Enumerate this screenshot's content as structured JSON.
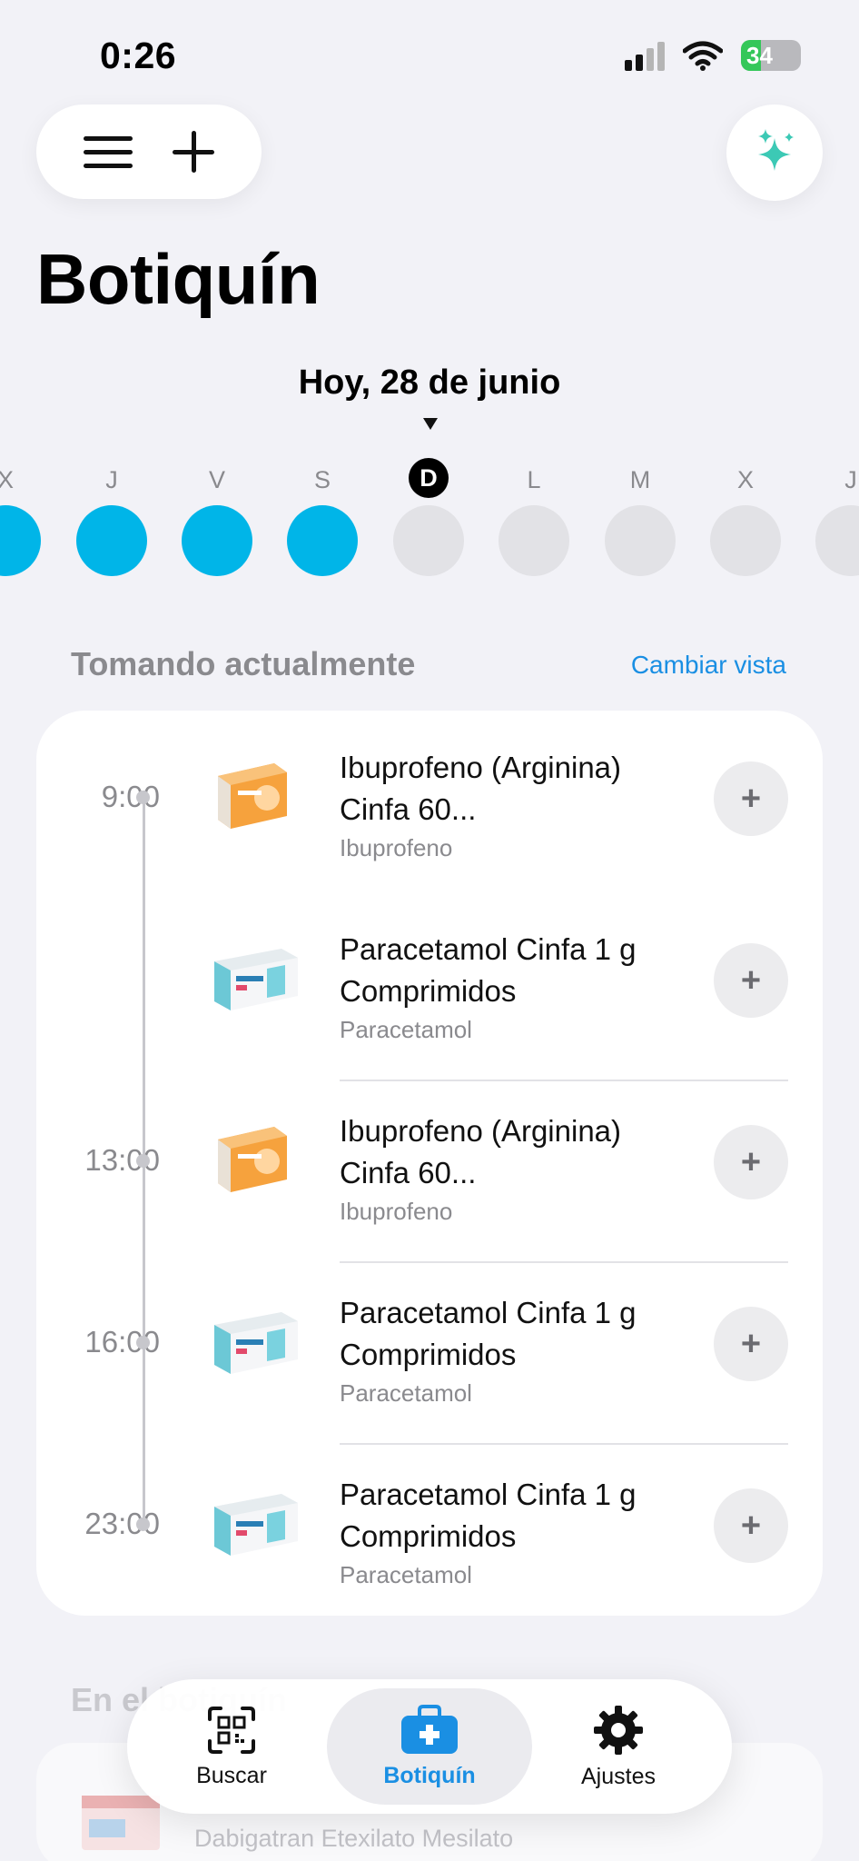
{
  "status_bar": {
    "time": "0:26",
    "battery": "34"
  },
  "header": {
    "title": "Botiquín"
  },
  "date_strip": {
    "label": "Hoy, 28 de junio",
    "days": [
      {
        "letter": "X",
        "taken": true,
        "today": false
      },
      {
        "letter": "J",
        "taken": true,
        "today": false
      },
      {
        "letter": "V",
        "taken": true,
        "today": false
      },
      {
        "letter": "S",
        "taken": true,
        "today": false
      },
      {
        "letter": "D",
        "taken": false,
        "today": true
      },
      {
        "letter": "L",
        "taken": false,
        "today": false
      },
      {
        "letter": "M",
        "taken": false,
        "today": false
      },
      {
        "letter": "X",
        "taken": false,
        "today": false
      },
      {
        "letter": "J",
        "taken": false,
        "today": false
      }
    ]
  },
  "current_section": {
    "title": "Tomando actualmente",
    "action": "Cambiar vista",
    "items": [
      {
        "time": "9:00",
        "name": "Ibuprofeno (Arginina) Cinfa 60...",
        "ingredient": "Ibuprofeno",
        "pack": "ibuprofeno",
        "add": "+"
      },
      {
        "time": "",
        "name": "Paracetamol Cinfa 1 g Comprimidos",
        "ingredient": "Paracetamol",
        "pack": "paracetamol",
        "add": "+"
      },
      {
        "time": "13:00",
        "name": "Ibuprofeno (Arginina) Cinfa 60...",
        "ingredient": "Ibuprofeno",
        "pack": "ibuprofeno",
        "add": "+"
      },
      {
        "time": "16:00",
        "name": "Paracetamol Cinfa 1 g Comprimidos",
        "ingredient": "Paracetamol",
        "pack": "paracetamol",
        "add": "+"
      },
      {
        "time": "23:00",
        "name": "Paracetamol Cinfa 1 g Comprimidos",
        "ingredient": "Paracetamol",
        "pack": "paracetamol",
        "add": "+"
      }
    ]
  },
  "next_section": {
    "title": "En el botiquín",
    "first_item": "Dabigatran Etexilato Mesilato"
  },
  "tabbar": {
    "tabs": [
      {
        "label": "Buscar",
        "icon": "qr-scan-icon",
        "active": false
      },
      {
        "label": "Botiquín",
        "icon": "first-aid-kit-icon",
        "active": true
      },
      {
        "label": "Ajustes",
        "icon": "gear-icon",
        "active": false
      }
    ]
  },
  "colors": {
    "accent": "#1a8fe3",
    "taken_day": "#00b5e8",
    "background": "#f2f2f7",
    "battery_green": "#34c759"
  }
}
